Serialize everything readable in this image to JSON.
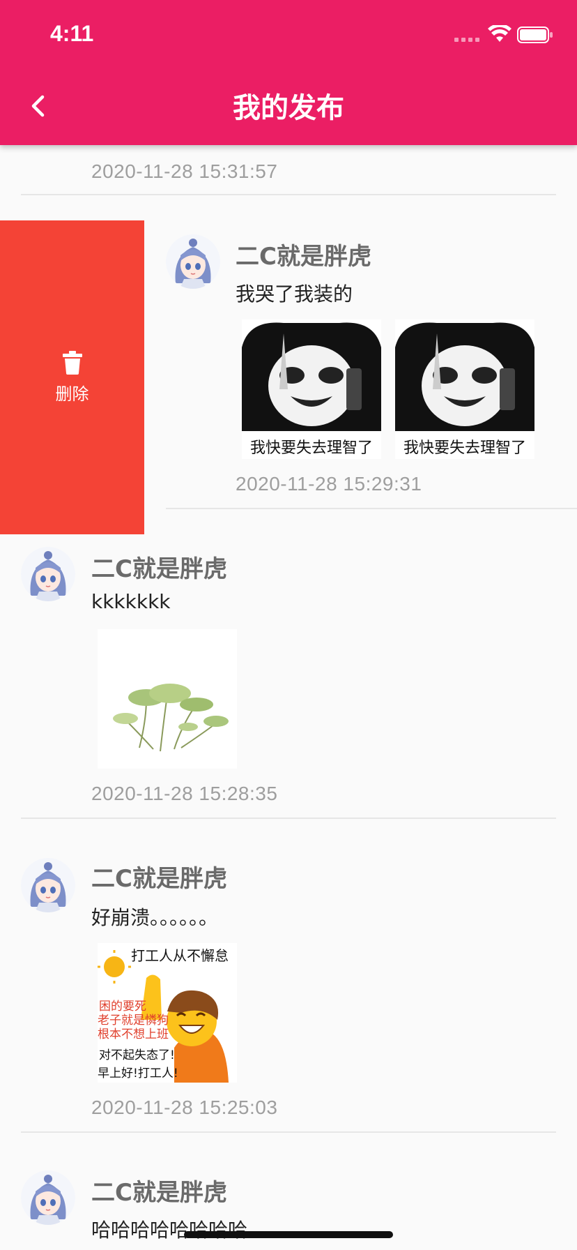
{
  "status_bar": {
    "time": "4:11"
  },
  "header": {
    "title": "我的发布",
    "back_icon": "chevron-left-icon"
  },
  "colors": {
    "accent": "#eb1e64",
    "delete": "#f44336",
    "timestamp": "#9e9e9e"
  },
  "delete_action": {
    "label": "删除",
    "icon": "trash-icon"
  },
  "posts": [
    {
      "time": "2020-11-28 15:31:57"
    },
    {
      "user": "二C就是胖虎",
      "text": "我哭了我装的",
      "images": [
        {
          "caption": "我快要失去理智了"
        },
        {
          "caption": "我快要失去理智了"
        }
      ],
      "time": "2020-11-28 15:29:31"
    },
    {
      "user": "二C就是胖虎",
      "text": "kkkkkkk",
      "time": "2020-11-28 15:28:35"
    },
    {
      "user": "二C就是胖虎",
      "text": "好崩溃。。。。。。",
      "image_text": {
        "top": "打工人从不懈怠",
        "red1": "困的要死",
        "red2": "老子就是憐狗",
        "red3": "根本不想上班",
        "black1": "对不起失态了!",
        "black2": "早上好!打工人!"
      },
      "time": "2020-11-28 15:25:03"
    },
    {
      "user": "二C就是胖虎",
      "text": "哈哈哈哈哈哈哈哈"
    }
  ]
}
